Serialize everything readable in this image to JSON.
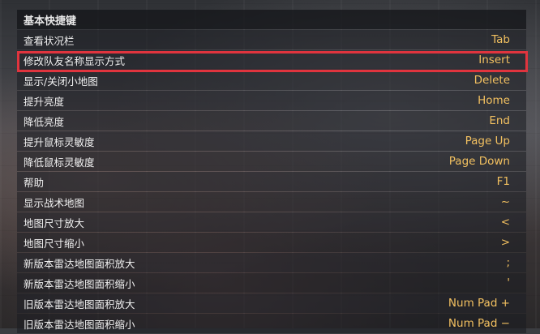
{
  "section": {
    "title": "基本快捷键"
  },
  "rows": [
    {
      "label": "查看状况栏",
      "key": "Tab"
    },
    {
      "label": "修改队友名称显示方式",
      "key": "Insert"
    },
    {
      "label": "显示/关闭小地图",
      "key": "Delete"
    },
    {
      "label": "提升亮度",
      "key": "Home"
    },
    {
      "label": "降低亮度",
      "key": "End"
    },
    {
      "label": "提升鼠标灵敏度",
      "key": "Page Up"
    },
    {
      "label": "降低鼠标灵敏度",
      "key": "Page Down"
    },
    {
      "label": "帮助",
      "key": "F1"
    },
    {
      "label": "显示战术地图",
      "key": "~"
    },
    {
      "label": "地图尺寸放大",
      "key": "<"
    },
    {
      "label": "地图尺寸缩小",
      "key": ">"
    },
    {
      "label": "新版本雷达地图面积放大",
      "key": ";"
    },
    {
      "label": "新版本雷达地图面积缩小",
      "key": "'"
    },
    {
      "label": "旧版本雷达地图面积放大",
      "key": "Num Pad +"
    },
    {
      "label": "旧版本雷达地图面积缩小",
      "key": "Num Pad −"
    }
  ],
  "highlight_color": "#e0343e",
  "key_color": "#f2c060"
}
